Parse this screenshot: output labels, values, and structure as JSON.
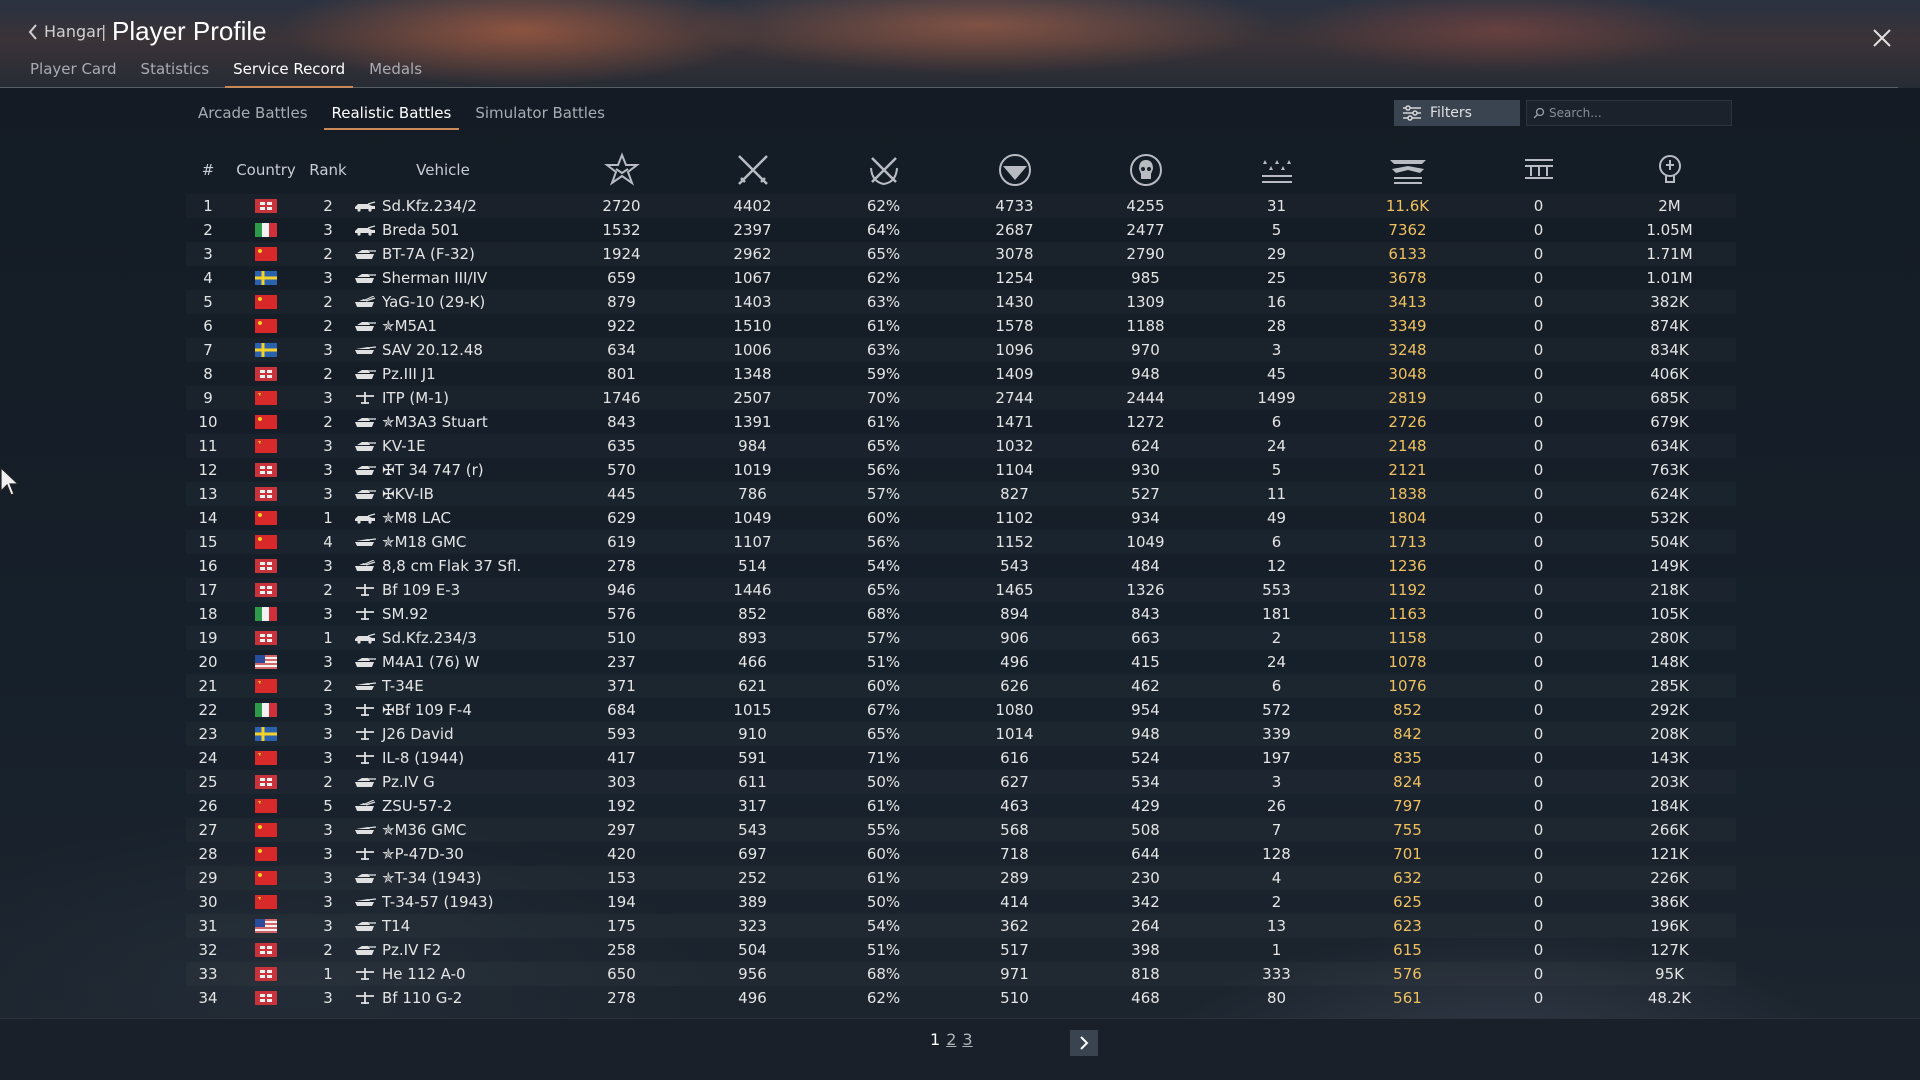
{
  "header": {
    "back_label": "Hangar",
    "separator": "|",
    "title": "Player Profile"
  },
  "main_tabs": [
    {
      "label": "Player Card",
      "active": false
    },
    {
      "label": "Statistics",
      "active": false
    },
    {
      "label": "Service Record",
      "active": true
    },
    {
      "label": "Medals",
      "active": false
    }
  ],
  "mode_tabs": [
    {
      "label": "Arcade Battles",
      "active": false
    },
    {
      "label": "Realistic Battles",
      "active": true
    },
    {
      "label": "Simulator Battles",
      "active": false
    }
  ],
  "toolbar": {
    "filters_label": "Filters",
    "search_placeholder": "Search..."
  },
  "columns": {
    "num": "#",
    "country": "Country",
    "rank": "Rank",
    "vehicle": "Vehicle",
    "stat_icons": [
      "battles-star-icon",
      "crossed-swords-icon",
      "wreath-swords-icon",
      "wing-shield-icon",
      "skull-icon",
      "three-stars-icon",
      "winged-chevrons-icon",
      "trophy-rows-icon",
      "lightbulb-icon"
    ]
  },
  "flag_colors": {
    "germany": "#c8343a",
    "italy": "#2e9a47",
    "china": "#d8282a",
    "ussr": "#d82a2a",
    "sweden": "#2a62b0",
    "usa": "#2a4a9a"
  },
  "accent_color": "#c98a5a",
  "gold_color": "#f0c060",
  "rows": [
    {
      "num": "1",
      "flag": "germany",
      "rank": "2",
      "vtype": "car",
      "vehicle": "Sd.Kfz.234/2",
      "s1": "2720",
      "s2": "4402",
      "s3": "62%",
      "s4": "4733",
      "s5": "4255",
      "s6": "31",
      "s7": "11.6K",
      "s8": "0",
      "s9": "2M"
    },
    {
      "num": "2",
      "flag": "italy",
      "rank": "3",
      "vtype": "car",
      "vehicle": "Breda 501",
      "s1": "1532",
      "s2": "2397",
      "s3": "64%",
      "s4": "2687",
      "s5": "2477",
      "s6": "5",
      "s7": "7362",
      "s8": "0",
      "s9": "1.05M"
    },
    {
      "num": "3",
      "flag": "china",
      "rank": "2",
      "vtype": "tank",
      "vehicle": "BT-7A (F-32)",
      "s1": "1924",
      "s2": "2962",
      "s3": "65%",
      "s4": "3078",
      "s5": "2790",
      "s6": "29",
      "s7": "6133",
      "s8": "0",
      "s9": "1.71M"
    },
    {
      "num": "4",
      "flag": "sweden",
      "rank": "3",
      "vtype": "tank",
      "vehicle": "Sherman III/IV",
      "s1": "659",
      "s2": "1067",
      "s3": "62%",
      "s4": "1254",
      "s5": "985",
      "s6": "25",
      "s7": "3678",
      "s8": "0",
      "s9": "1.01M"
    },
    {
      "num": "5",
      "flag": "china",
      "rank": "2",
      "vtype": "spaa",
      "vehicle": "YaG-10 (29-K)",
      "s1": "879",
      "s2": "1403",
      "s3": "63%",
      "s4": "1430",
      "s5": "1309",
      "s6": "16",
      "s7": "3413",
      "s8": "0",
      "s9": "382K"
    },
    {
      "num": "6",
      "flag": "china",
      "rank": "2",
      "vtype": "tank",
      "vehicle": "✯M5A1",
      "s1": "922",
      "s2": "1510",
      "s3": "61%",
      "s4": "1578",
      "s5": "1188",
      "s6": "28",
      "s7": "3349",
      "s8": "0",
      "s9": "874K"
    },
    {
      "num": "7",
      "flag": "sweden",
      "rank": "3",
      "vtype": "td",
      "vehicle": "SAV 20.12.48",
      "s1": "634",
      "s2": "1006",
      "s3": "63%",
      "s4": "1096",
      "s5": "970",
      "s6": "3",
      "s7": "3248",
      "s8": "0",
      "s9": "834K"
    },
    {
      "num": "8",
      "flag": "germany",
      "rank": "2",
      "vtype": "tank",
      "vehicle": "Pz.III J1",
      "s1": "801",
      "s2": "1348",
      "s3": "59%",
      "s4": "1409",
      "s5": "948",
      "s6": "45",
      "s7": "3048",
      "s8": "0",
      "s9": "406K"
    },
    {
      "num": "9",
      "flag": "ussr",
      "rank": "3",
      "vtype": "plane",
      "vehicle": "ITP (M-1)",
      "s1": "1746",
      "s2": "2507",
      "s3": "70%",
      "s4": "2744",
      "s5": "2444",
      "s6": "1499",
      "s7": "2819",
      "s8": "0",
      "s9": "685K"
    },
    {
      "num": "10",
      "flag": "china",
      "rank": "2",
      "vtype": "tank",
      "vehicle": "✯M3A3 Stuart",
      "s1": "843",
      "s2": "1391",
      "s3": "61%",
      "s4": "1471",
      "s5": "1272",
      "s6": "6",
      "s7": "2726",
      "s8": "0",
      "s9": "679K"
    },
    {
      "num": "11",
      "flag": "ussr",
      "rank": "3",
      "vtype": "tank",
      "vehicle": "KV-1E",
      "s1": "635",
      "s2": "984",
      "s3": "65%",
      "s4": "1032",
      "s5": "624",
      "s6": "24",
      "s7": "2148",
      "s8": "0",
      "s9": "634K"
    },
    {
      "num": "12",
      "flag": "germany",
      "rank": "3",
      "vtype": "tank",
      "vehicle": "✠T 34 747 (r)",
      "s1": "570",
      "s2": "1019",
      "s3": "56%",
      "s4": "1104",
      "s5": "930",
      "s6": "5",
      "s7": "2121",
      "s8": "0",
      "s9": "763K"
    },
    {
      "num": "13",
      "flag": "germany",
      "rank": "3",
      "vtype": "tank",
      "vehicle": "✠KV-IB",
      "s1": "445",
      "s2": "786",
      "s3": "57%",
      "s4": "827",
      "s5": "527",
      "s6": "11",
      "s7": "1838",
      "s8": "0",
      "s9": "624K"
    },
    {
      "num": "14",
      "flag": "china",
      "rank": "1",
      "vtype": "car",
      "vehicle": "✯M8 LAC",
      "s1": "629",
      "s2": "1049",
      "s3": "60%",
      "s4": "1102",
      "s5": "934",
      "s6": "49",
      "s7": "1804",
      "s8": "0",
      "s9": "532K"
    },
    {
      "num": "15",
      "flag": "china",
      "rank": "4",
      "vtype": "td",
      "vehicle": "✯M18 GMC",
      "s1": "619",
      "s2": "1107",
      "s3": "56%",
      "s4": "1152",
      "s5": "1049",
      "s6": "6",
      "s7": "1713",
      "s8": "0",
      "s9": "504K"
    },
    {
      "num": "16",
      "flag": "germany",
      "rank": "3",
      "vtype": "spaa",
      "vehicle": "8,8 cm Flak 37 Sfl.",
      "s1": "278",
      "s2": "514",
      "s3": "54%",
      "s4": "543",
      "s5": "484",
      "s6": "12",
      "s7": "1236",
      "s8": "0",
      "s9": "149K"
    },
    {
      "num": "17",
      "flag": "germany",
      "rank": "2",
      "vtype": "plane",
      "vehicle": "Bf 109 E-3",
      "s1": "946",
      "s2": "1446",
      "s3": "65%",
      "s4": "1465",
      "s5": "1326",
      "s6": "553",
      "s7": "1192",
      "s8": "0",
      "s9": "218K"
    },
    {
      "num": "18",
      "flag": "italy",
      "rank": "3",
      "vtype": "plane",
      "vehicle": "SM.92",
      "s1": "576",
      "s2": "852",
      "s3": "68%",
      "s4": "894",
      "s5": "843",
      "s6": "181",
      "s7": "1163",
      "s8": "0",
      "s9": "105K"
    },
    {
      "num": "19",
      "flag": "germany",
      "rank": "1",
      "vtype": "car",
      "vehicle": "Sd.Kfz.234/3",
      "s1": "510",
      "s2": "893",
      "s3": "57%",
      "s4": "906",
      "s5": "663",
      "s6": "2",
      "s7": "1158",
      "s8": "0",
      "s9": "280K"
    },
    {
      "num": "20",
      "flag": "usa",
      "rank": "3",
      "vtype": "tank",
      "vehicle": "M4A1 (76) W",
      "s1": "237",
      "s2": "466",
      "s3": "51%",
      "s4": "496",
      "s5": "415",
      "s6": "24",
      "s7": "1078",
      "s8": "0",
      "s9": "148K"
    },
    {
      "num": "21",
      "flag": "ussr",
      "rank": "2",
      "vtype": "td",
      "vehicle": "T-34E",
      "s1": "371",
      "s2": "621",
      "s3": "60%",
      "s4": "626",
      "s5": "462",
      "s6": "6",
      "s7": "1076",
      "s8": "0",
      "s9": "285K"
    },
    {
      "num": "22",
      "flag": "italy",
      "rank": "3",
      "vtype": "plane",
      "vehicle": "✠Bf 109 F-4",
      "s1": "684",
      "s2": "1015",
      "s3": "67%",
      "s4": "1080",
      "s5": "954",
      "s6": "572",
      "s7": "852",
      "s8": "0",
      "s9": "292K"
    },
    {
      "num": "23",
      "flag": "sweden",
      "rank": "3",
      "vtype": "plane",
      "vehicle": "J26 David",
      "s1": "593",
      "s2": "910",
      "s3": "65%",
      "s4": "1014",
      "s5": "948",
      "s6": "339",
      "s7": "842",
      "s8": "0",
      "s9": "208K"
    },
    {
      "num": "24",
      "flag": "ussr",
      "rank": "3",
      "vtype": "plane",
      "vehicle": "IL-8 (1944)",
      "s1": "417",
      "s2": "591",
      "s3": "71%",
      "s4": "616",
      "s5": "524",
      "s6": "197",
      "s7": "835",
      "s8": "0",
      "s9": "143K"
    },
    {
      "num": "25",
      "flag": "germany",
      "rank": "2",
      "vtype": "tank",
      "vehicle": "Pz.IV G",
      "s1": "303",
      "s2": "611",
      "s3": "50%",
      "s4": "627",
      "s5": "534",
      "s6": "3",
      "s7": "824",
      "s8": "0",
      "s9": "203K"
    },
    {
      "num": "26",
      "flag": "ussr",
      "rank": "5",
      "vtype": "spaa",
      "vehicle": "ZSU-57-2",
      "s1": "192",
      "s2": "317",
      "s3": "61%",
      "s4": "463",
      "s5": "429",
      "s6": "26",
      "s7": "797",
      "s8": "0",
      "s9": "184K"
    },
    {
      "num": "27",
      "flag": "china",
      "rank": "3",
      "vtype": "td",
      "vehicle": "✯M36 GMC",
      "s1": "297",
      "s2": "543",
      "s3": "55%",
      "s4": "568",
      "s5": "508",
      "s6": "7",
      "s7": "755",
      "s8": "0",
      "s9": "266K"
    },
    {
      "num": "28",
      "flag": "china",
      "rank": "3",
      "vtype": "plane",
      "vehicle": "✯P-47D-30",
      "s1": "420",
      "s2": "697",
      "s3": "60%",
      "s4": "718",
      "s5": "644",
      "s6": "128",
      "s7": "701",
      "s8": "0",
      "s9": "121K"
    },
    {
      "num": "29",
      "flag": "china",
      "rank": "3",
      "vtype": "tank",
      "vehicle": "✯T-34 (1943)",
      "s1": "153",
      "s2": "252",
      "s3": "61%",
      "s4": "289",
      "s5": "230",
      "s6": "4",
      "s7": "632",
      "s8": "0",
      "s9": "226K"
    },
    {
      "num": "30",
      "flag": "ussr",
      "rank": "3",
      "vtype": "td",
      "vehicle": "T-34-57 (1943)",
      "s1": "194",
      "s2": "389",
      "s3": "50%",
      "s4": "414",
      "s5": "342",
      "s6": "2",
      "s7": "625",
      "s8": "0",
      "s9": "386K"
    },
    {
      "num": "31",
      "flag": "usa",
      "rank": "3",
      "vtype": "tank",
      "vehicle": "T14",
      "s1": "175",
      "s2": "323",
      "s3": "54%",
      "s4": "362",
      "s5": "264",
      "s6": "13",
      "s7": "623",
      "s8": "0",
      "s9": "196K"
    },
    {
      "num": "32",
      "flag": "germany",
      "rank": "2",
      "vtype": "tank",
      "vehicle": "Pz.IV F2",
      "s1": "258",
      "s2": "504",
      "s3": "51%",
      "s4": "517",
      "s5": "398",
      "s6": "1",
      "s7": "615",
      "s8": "0",
      "s9": "127K"
    },
    {
      "num": "33",
      "flag": "germany",
      "rank": "1",
      "vtype": "plane",
      "vehicle": "He 112 A-0",
      "s1": "650",
      "s2": "956",
      "s3": "68%",
      "s4": "971",
      "s5": "818",
      "s6": "333",
      "s7": "576",
      "s8": "0",
      "s9": "95K"
    },
    {
      "num": "34",
      "flag": "germany",
      "rank": "3",
      "vtype": "plane",
      "vehicle": "Bf 110 G-2",
      "s1": "278",
      "s2": "496",
      "s3": "62%",
      "s4": "510",
      "s5": "468",
      "s6": "80",
      "s7": "561",
      "s8": "0",
      "s9": "48.2K"
    }
  ],
  "pager": {
    "pages": [
      {
        "label": "1",
        "active": true
      },
      {
        "label": "2",
        "active": false
      },
      {
        "label": "3",
        "active": false
      }
    ],
    "next_icon": "chevron-right-icon"
  }
}
